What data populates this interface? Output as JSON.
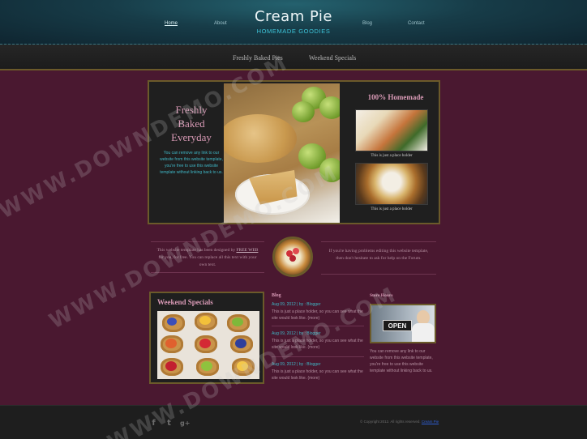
{
  "header": {
    "nav": [
      "Home",
      "About",
      "Blog",
      "Contact"
    ],
    "logo_title": "Cream Pie",
    "logo_subtitle": "HOMEMADE GOODIES"
  },
  "subnav": {
    "items": [
      "Freshly Baked Pies",
      "Weekend Specials"
    ]
  },
  "hero": {
    "title_lines": [
      "Freshly",
      "Baked",
      "Everyday"
    ],
    "text": "You can remove any link to our website from this website template, you're free to use this website template without linking back to us.",
    "side_title": "100% Homemade",
    "captions": [
      "This is just a place holder",
      "This is just a place holder"
    ]
  },
  "middle": {
    "left_text_before": "This website template has been designed by",
    "left_link": "FREE WEB",
    "left_text_after": "for you, for free. You can replace all this text with your own text.",
    "right_text": "If you're having problems editing this website template, then don't hesitate to ask for help on the Forum."
  },
  "specials": {
    "title": "Weekend Specials"
  },
  "blog": {
    "heading": "Blog",
    "posts": [
      {
        "date": "Aug 09, 2012 | by : Blogger",
        "body": "This is just a place holder, so you can see what the site would look like.",
        "more": "(more)"
      },
      {
        "date": "Aug 09, 2012 | by : Blogger",
        "body": "This is just a place holder, so you can see what the site would look like.",
        "more": "(more)"
      },
      {
        "date": "Aug 09, 2012 | by : Blogger",
        "body": "This is just a place holder, so you can see what the site would look like.",
        "more": "(more)"
      }
    ]
  },
  "store": {
    "heading": "Store Hours",
    "sign": "OPEN",
    "text": "You can remove any link to our website from this website template, you're free to use this website template without linking back to us."
  },
  "footer": {
    "social_icons": [
      "facebook-icon",
      "twitter-icon",
      "googleplus-icon"
    ],
    "social_glyphs": [
      "f",
      "t",
      "g+"
    ],
    "copyright": "© Copyright 2012. All rights reserved.",
    "copyright_link": "Cream Pie"
  },
  "watermark": {
    "text": "WWW.DOWNDEMO.COM"
  },
  "colors": {
    "page_background": "#4a1830",
    "header_teal": "#173c48",
    "accent_pink": "#d99ab6",
    "accent_cyan": "#3fb7c6",
    "frame_gold": "#6b5a2a"
  }
}
